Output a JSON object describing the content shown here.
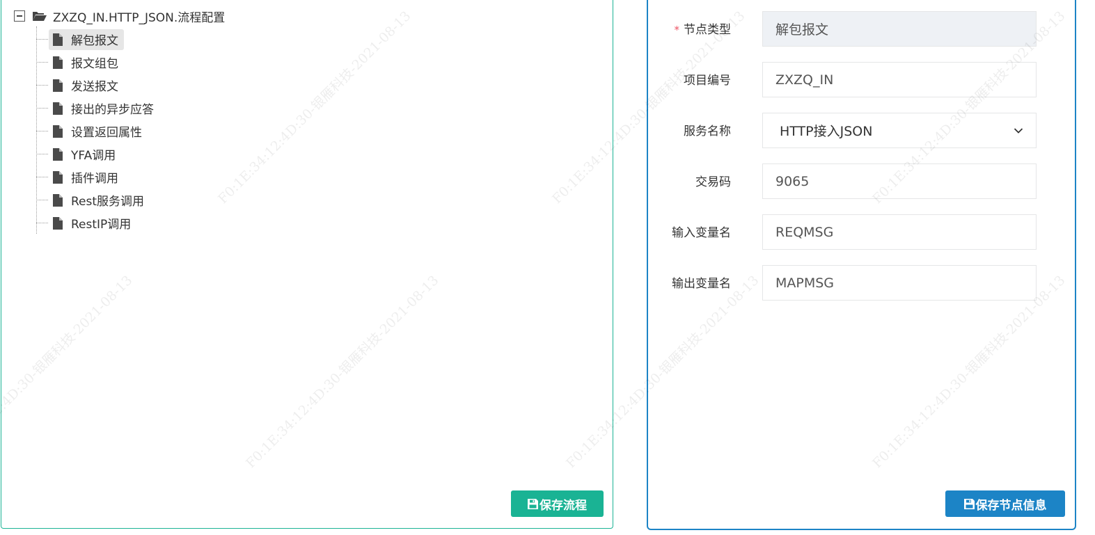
{
  "tree": {
    "root_label": "ZXZQ_IN.HTTP_JSON.流程配置",
    "items": [
      {
        "label": "解包报文",
        "selected": true
      },
      {
        "label": "报文组包",
        "selected": false
      },
      {
        "label": "发送报文",
        "selected": false
      },
      {
        "label": "接出的异步应答",
        "selected": false
      },
      {
        "label": "设置返回属性",
        "selected": false
      },
      {
        "label": "YFA调用",
        "selected": false
      },
      {
        "label": "插件调用",
        "selected": false
      },
      {
        "label": "Rest服务调用",
        "selected": false
      },
      {
        "label": "RestIP调用",
        "selected": false
      }
    ]
  },
  "left_panel": {
    "save_flow_label": "保存流程"
  },
  "form": {
    "node_type": {
      "required_mark": "*",
      "label": "节点类型",
      "value": "解包报文"
    },
    "project_code": {
      "label": "项目编号",
      "value": "ZXZQ_IN"
    },
    "service_name": {
      "label": "服务名称",
      "value": "HTTP接入JSON"
    },
    "transaction_code": {
      "label": "交易码",
      "value": "9065"
    },
    "input_var": {
      "label": "输入变量名",
      "value": "REQMSG"
    },
    "output_var": {
      "label": "输出变量名",
      "value": "MAPMSG"
    },
    "save_node_label": "保存节点信息"
  },
  "watermark": {
    "text": "F0:1E:34:12:4D:30-银雁科技-2021-08-13"
  },
  "colors": {
    "primary_green": "#1ab394",
    "primary_blue": "#1c84c6",
    "required_red": "#ed5565",
    "readonly_bg": "#eef1f5"
  },
  "icons": {
    "collapse": "minus-square-icon",
    "root": "folder-open-icon",
    "node": "file-icon",
    "save": "floppy-disk-icon",
    "select": "chevron-down-icon"
  }
}
